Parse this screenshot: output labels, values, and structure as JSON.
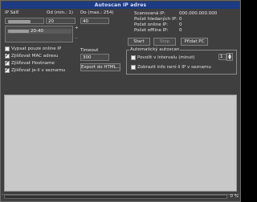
{
  "window": {
    "title": "Autoscan IP adres"
  },
  "range": {
    "ip_label": "IP Sáíť",
    "from_label": "Od (min.: 1)",
    "to_label": "Do (max.: 254)",
    "ip_value": "",
    "from_value": "20",
    "to_value": "40",
    "range_display": "20-40",
    "add_symbol": "+",
    "remove_symbol": "-"
  },
  "options": {
    "only_online": "Vypsat pouze online IP",
    "mac": "Zjišťovat MAC adresu",
    "hostname": "Zjišťovat Hostname",
    "list": "Zjišťovat je-li v seznamu"
  },
  "timeout": {
    "label": "Timeout",
    "value": "300"
  },
  "export": {
    "label": "Export do HTML..."
  },
  "stats": {
    "scanned_label": "Scanovaná IP:",
    "scanned_value": "000.000.000.000",
    "searched_label": "Počet hledaných IP:",
    "searched_value": "0",
    "online_label": "Počet online IP:",
    "online_value": "0",
    "offline_label": "Počet offline IP:",
    "offline_value": "0"
  },
  "buttons": {
    "start": "Start",
    "stop": "Stop",
    "add_pc": "Přidat PC"
  },
  "auto": {
    "group_label": "Automatický autoscan",
    "interval_label": "Povolit v intervalu (minut)",
    "interval_value": "1",
    "info_label": "Zobrazit info není-li IP v seznamu"
  },
  "status": {
    "progress_label": "0 %",
    "progress": 0
  }
}
